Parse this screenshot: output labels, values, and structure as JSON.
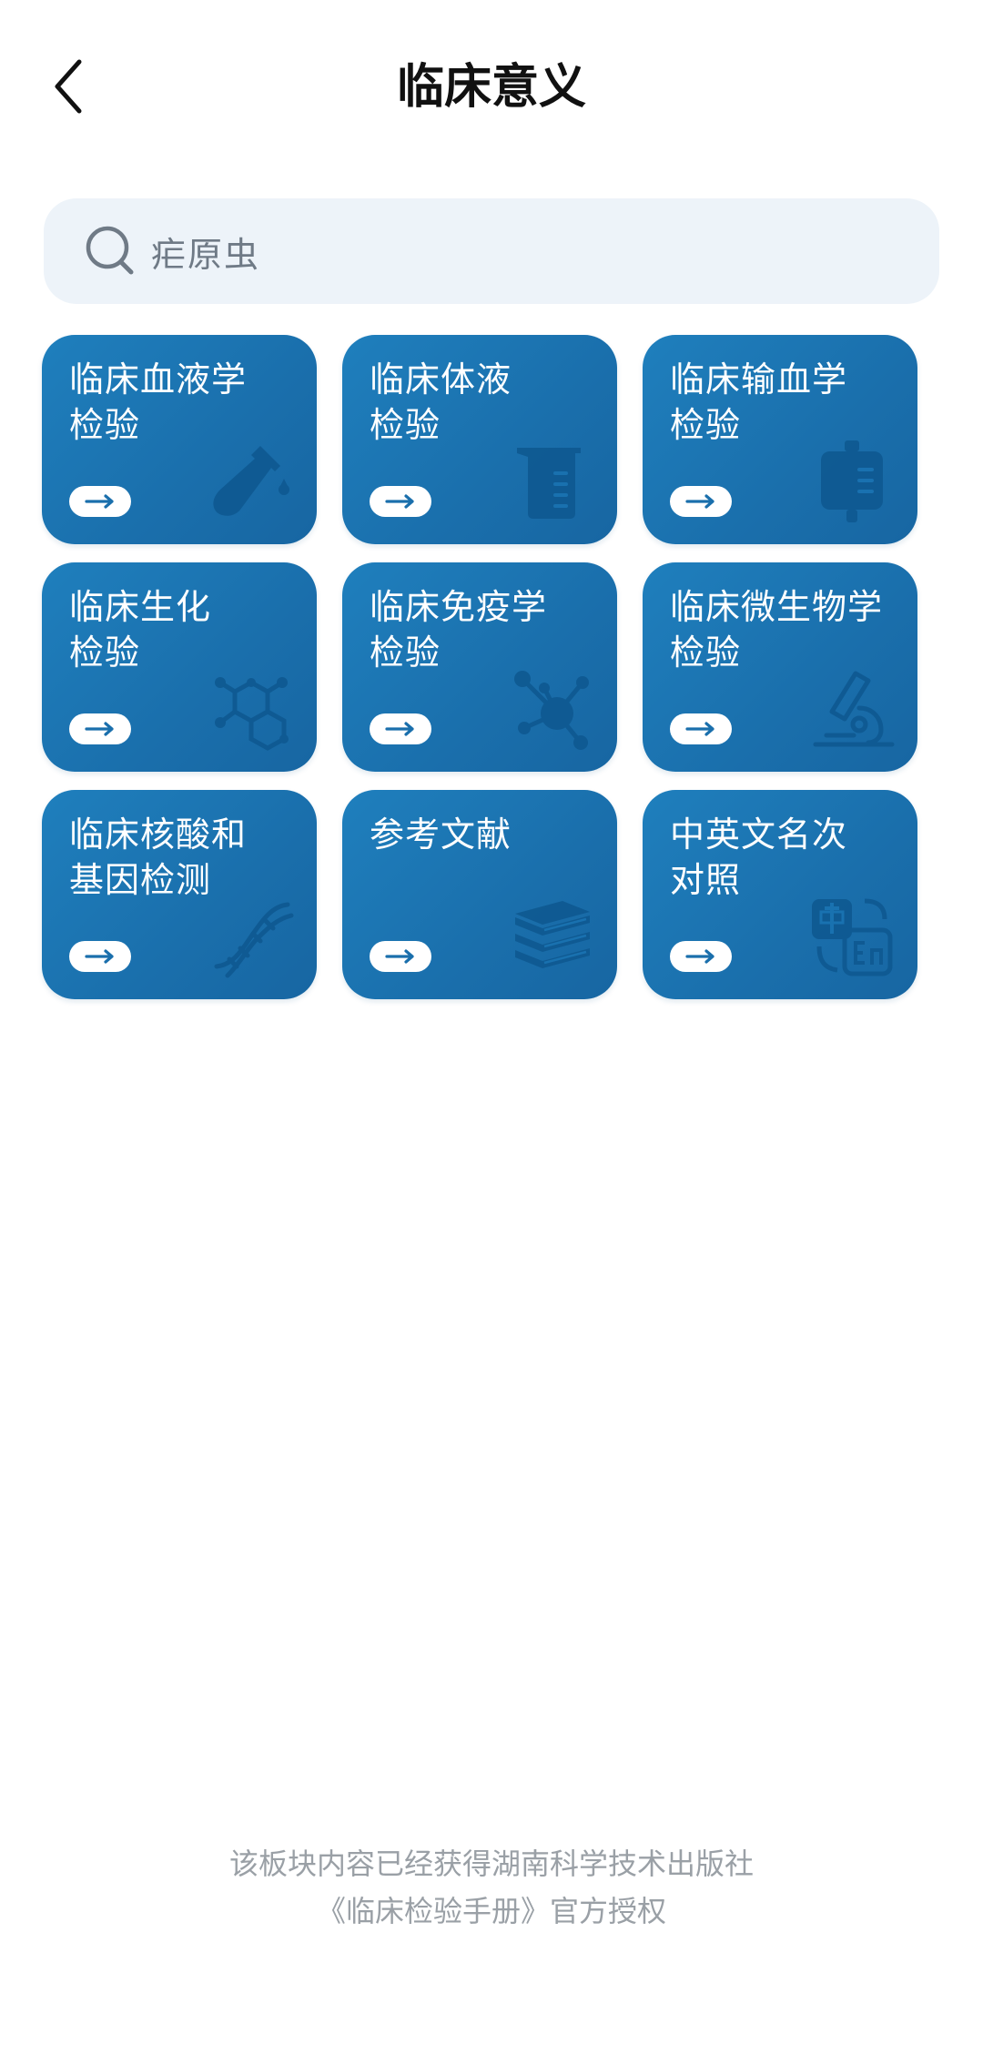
{
  "header": {
    "title": "临床意义",
    "back_icon": "chevron-left-icon"
  },
  "search": {
    "icon": "search-icon",
    "value": "疟原虫"
  },
  "cards": [
    {
      "title": "临床血液学\n检验",
      "icon": "test-tube-icon"
    },
    {
      "title": "临床体液\n检验",
      "icon": "beaker-icon"
    },
    {
      "title": "临床输血学\n检验",
      "icon": "blood-bag-icon"
    },
    {
      "title": "临床生化\n检验",
      "icon": "molecule-icon"
    },
    {
      "title": "临床免疫学\n检验",
      "icon": "immune-network-icon"
    },
    {
      "title": "临床微生物学\n检验",
      "icon": "microscope-icon"
    },
    {
      "title": "临床核酸和\n基因检测",
      "icon": "dna-icon"
    },
    {
      "title": "参考文献",
      "icon": "books-icon"
    },
    {
      "title": "中英文名次\n对照",
      "icon": "translate-icon"
    }
  ],
  "colors": {
    "card": "#1a72b0",
    "search_bg": "#edf3f9",
    "footer_text": "#9aa0a6"
  },
  "footer": {
    "line1": "该板块内容已经获得湖南科学技术出版社",
    "line2": "《临床检验手册》官方授权"
  }
}
